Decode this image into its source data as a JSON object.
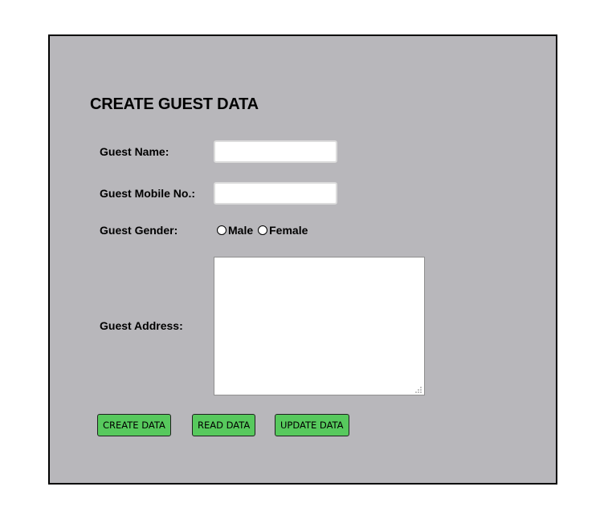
{
  "form": {
    "title": "CREATE GUEST DATA",
    "name_label": "Guest Name:",
    "name_value": "",
    "mobile_label": "Guest Mobile No.:",
    "mobile_value": "",
    "gender_label": "Guest Gender:",
    "gender_options": [
      "Male",
      "Female"
    ],
    "gender_selected": null,
    "address_label": "Guest Address:",
    "address_value": ""
  },
  "buttons": {
    "create_label": "CREATE DATA",
    "read_label": "READ DATA",
    "update_label": "UPDATE DATA"
  },
  "colors": {
    "panel_background": "#b8b7bb",
    "button_background": "#57c95d",
    "panel_border": "#000000"
  }
}
